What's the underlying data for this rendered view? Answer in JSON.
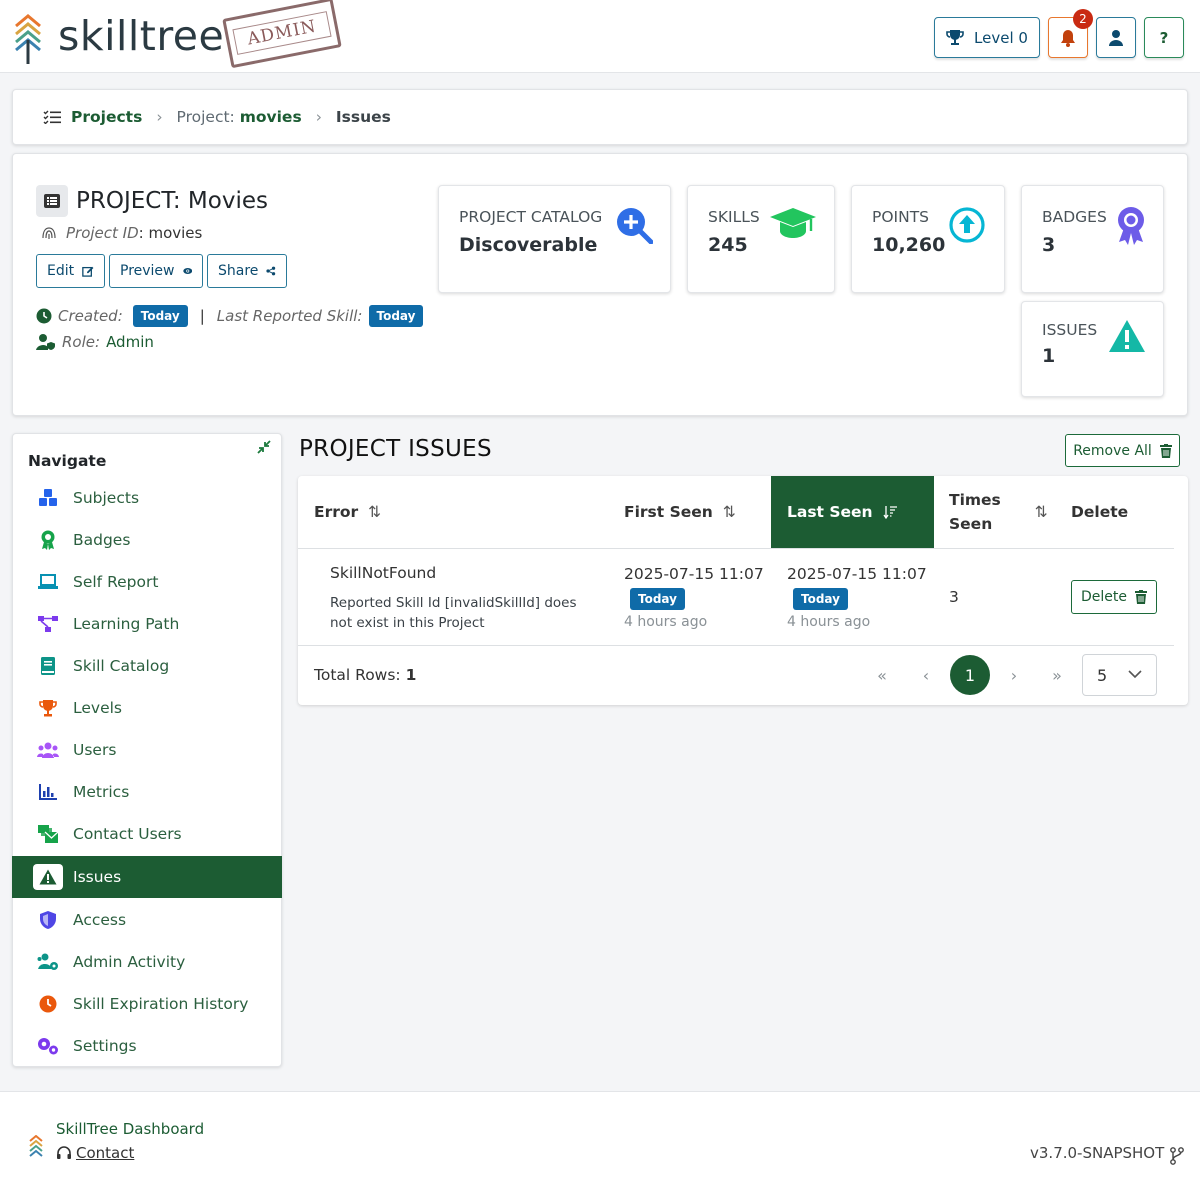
{
  "header": {
    "logo_text": "skilltree",
    "stamp_text": "ADMIN",
    "level_label": "Level 0",
    "notification_count": "2",
    "help_label": "?"
  },
  "breadcrumb": {
    "projects": "Projects",
    "project_prefix": "Project:",
    "project_name": "movies",
    "current": "Issues"
  },
  "project": {
    "title": "PROJECT: Movies",
    "id_label": "Project ID",
    "id_value": ": movies",
    "edit_label": "Edit",
    "preview_label": "Preview",
    "share_label": "Share",
    "created_label": "Created:",
    "created_value": "Today",
    "separator": "|",
    "last_reported_label": "Last Reported Skill:",
    "last_reported_value": "Today",
    "role_label": "Role:",
    "role_value": "Admin"
  },
  "stats": {
    "catalog": {
      "label": "PROJECT CATALOG",
      "value": "Discoverable"
    },
    "skills": {
      "label": "SKILLS",
      "value": "245"
    },
    "points": {
      "label": "POINTS",
      "value": "10,260"
    },
    "badges": {
      "label": "BADGES",
      "value": "3"
    },
    "issues": {
      "label": "ISSUES",
      "value": "1"
    }
  },
  "nav": {
    "title": "Navigate",
    "items": [
      {
        "label": "Subjects",
        "icon": "cubes-icon",
        "color": "#2563eb"
      },
      {
        "label": "Badges",
        "icon": "award-icon",
        "color": "#16a34a"
      },
      {
        "label": "Self Report",
        "icon": "laptop-icon",
        "color": "#0891b2"
      },
      {
        "label": "Learning Path",
        "icon": "diagram-icon",
        "color": "#7c3aed"
      },
      {
        "label": "Skill Catalog",
        "icon": "book-icon",
        "color": "#0d9488"
      },
      {
        "label": "Levels",
        "icon": "trophy-icon",
        "color": "#ea580c"
      },
      {
        "label": "Users",
        "icon": "users-icon",
        "color": "#a855f7"
      },
      {
        "label": "Metrics",
        "icon": "chart-icon",
        "color": "#1e40af"
      },
      {
        "label": "Contact Users",
        "icon": "mail-bulk-icon",
        "color": "#16a34a"
      },
      {
        "label": "Issues",
        "icon": "warning-icon",
        "color": "#1c5c33"
      },
      {
        "label": "Access",
        "icon": "shield-icon",
        "color": "#4f46e5"
      },
      {
        "label": "Admin Activity",
        "icon": "users-cog-icon",
        "color": "#0d9488"
      },
      {
        "label": "Skill Expiration History",
        "icon": "clock-icon",
        "color": "#ea580c"
      },
      {
        "label": "Settings",
        "icon": "cogs-icon",
        "color": "#7c3aed"
      }
    ]
  },
  "issues": {
    "title": "PROJECT ISSUES",
    "remove_all_label": "Remove All",
    "columns": {
      "error": "Error",
      "first_seen": "First Seen",
      "last_seen": "Last Seen",
      "times_seen_1": "Times",
      "times_seen_2": "Seen",
      "delete": "Delete"
    },
    "rows": [
      {
        "error": "SkillNotFound",
        "message": "Reported Skill Id [invalidSkillId] does not exist in this Project",
        "first_seen": "2025-07-15 11:07",
        "first_seen_badge": "Today",
        "first_seen_ago": "4 hours ago",
        "last_seen": "2025-07-15 11:07",
        "last_seen_badge": "Today",
        "last_seen_ago": "4 hours ago",
        "times_seen": "3",
        "delete_label": "Delete"
      }
    ],
    "total_rows_label": "Total Rows:",
    "total_rows_value": "1",
    "current_page": "1",
    "page_size": "5"
  },
  "footer": {
    "app_name": "SkillTree Dashboard",
    "contact_label": "Contact",
    "version": "v3.7.0-SNAPSHOT"
  }
}
